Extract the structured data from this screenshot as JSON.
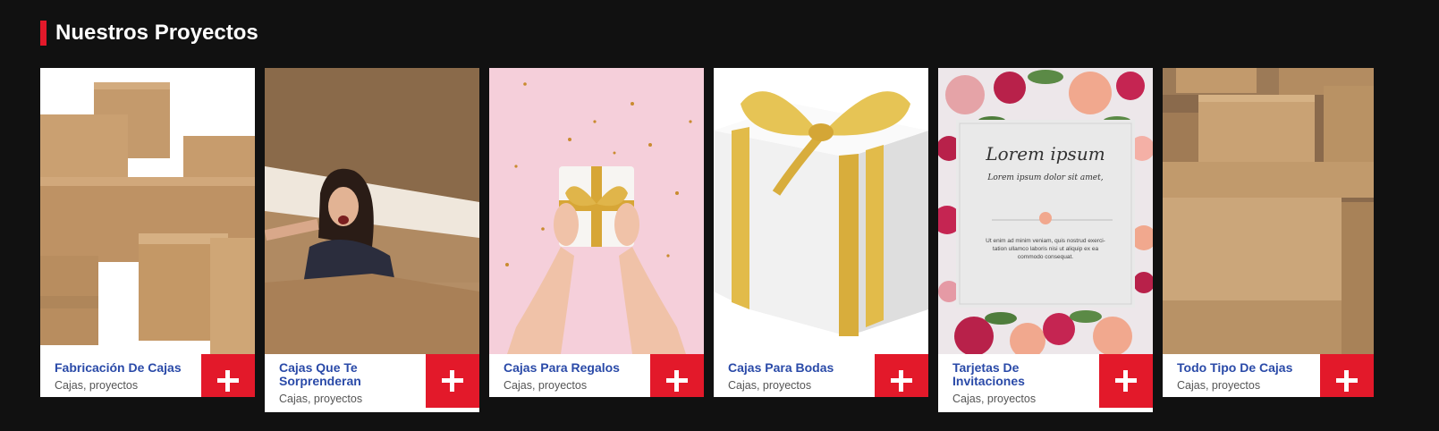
{
  "section": {
    "title": "Nuestros Proyectos"
  },
  "accent_color": "#e3192a",
  "title_color": "#2a4aa8",
  "projects": [
    {
      "title": "Fabricación De Cajas",
      "meta": "Cajas, proyectos",
      "image": "stacked-cardboard-boxes-image",
      "button_icon": "plus-icon"
    },
    {
      "title": "Cajas Que Te Sorprenderan",
      "meta": "Cajas, proyectos",
      "image": "surprised-woman-in-box-image",
      "button_icon": "plus-icon"
    },
    {
      "title": "Cajas Para Regalos",
      "meta": "Cajas, proyectos",
      "image": "hands-holding-gift-image",
      "button_icon": "plus-icon"
    },
    {
      "title": "Cajas Para Bodas",
      "meta": "Cajas, proyectos",
      "image": "white-gift-box-gold-ribbon-image",
      "button_icon": "plus-icon"
    },
    {
      "title": "Tarjetas De Invitaciones",
      "meta": "Cajas, proyectos",
      "image": "floral-invitation-card-image",
      "button_icon": "plus-icon",
      "card_text": {
        "heading": "Lorem ipsum",
        "subheading": "Lorem ipsum dolor sit amet,",
        "line1": "Ut enim ad minim veniam, quis nostrud exerci-",
        "line2": "tation ullamco laboris nisi ut aliquip ex ea",
        "line3": "commodo consequat."
      }
    },
    {
      "title": "Todo Tipo De Cajas",
      "meta": "Cajas, proyectos",
      "image": "warehouse-boxes-image",
      "button_icon": "plus-icon"
    }
  ]
}
